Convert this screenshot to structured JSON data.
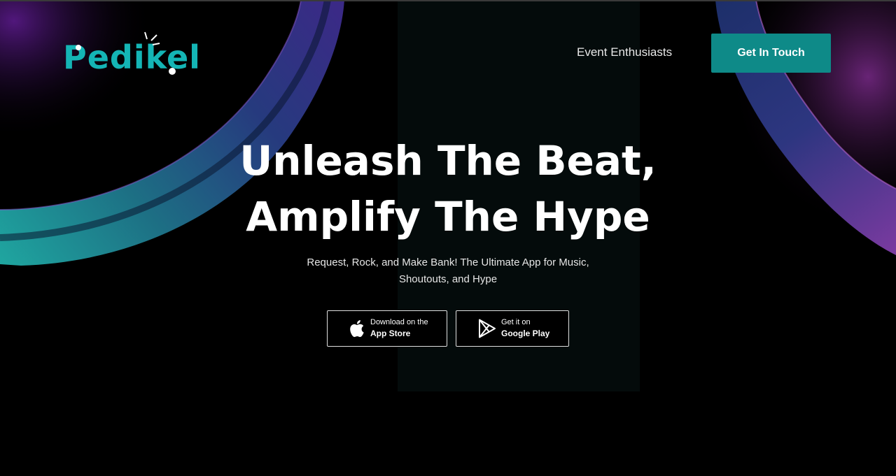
{
  "brand": {
    "logo_text": "Pedikel",
    "accent_color": "#14b5b5"
  },
  "nav": {
    "event_link": "Event Enthusiasts",
    "cta_label": "Get In Touch",
    "cta_color": "#0e8a88"
  },
  "hero": {
    "headline_line1": "Unleash The Beat,",
    "headline_line2": "Amplify The Hype",
    "subtitle": "Request, Rock, and Make Bank! The Ultimate App for Music, Shoutouts, and Hype"
  },
  "badges": {
    "appstore": {
      "small": "Download on the",
      "big": "App Store",
      "icon": "apple-icon"
    },
    "googleplay": {
      "small": "Get it on",
      "big": "Google Play",
      "icon": "google-play-icon"
    }
  }
}
